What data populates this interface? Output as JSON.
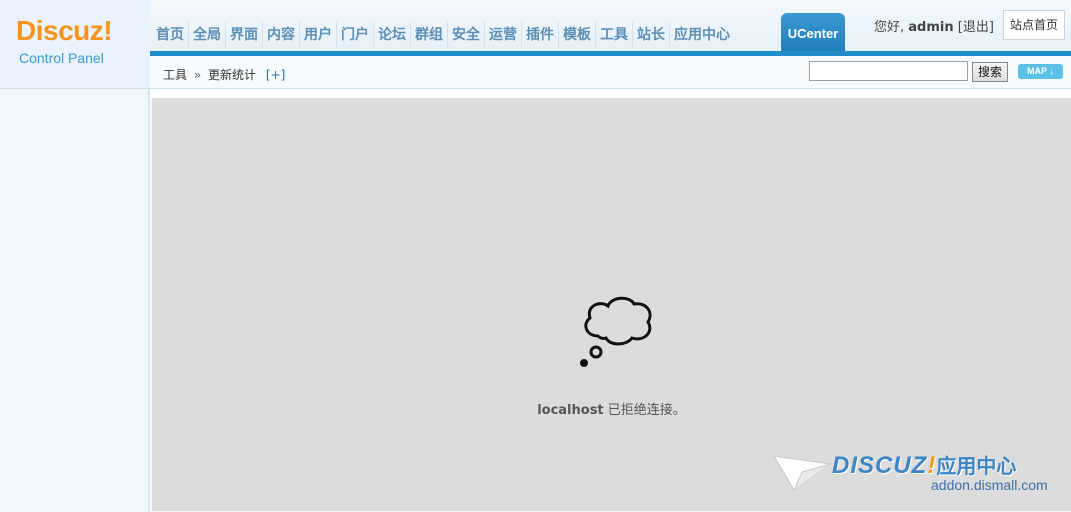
{
  "logo": {
    "word": "Discuz!",
    "sub": "Control Panel"
  },
  "nav": {
    "items": [
      "首页",
      "全局",
      "界面",
      "内容",
      "用户",
      "门户",
      "论坛",
      "群组",
      "安全",
      "运营",
      "插件",
      "模板",
      "工具",
      "站长",
      "应用中心"
    ],
    "active": "UCenter"
  },
  "user": {
    "greeting": "您好,",
    "name": "admin",
    "logout": "[退出]"
  },
  "home_button": "站点首页",
  "breadcrumb": {
    "section": "工具",
    "sep": "»",
    "page": "更新统计",
    "add": "[+]"
  },
  "search": {
    "value": "",
    "button": "搜索"
  },
  "map_button": "MAP",
  "error": {
    "host": "localhost",
    "message": "已拒绝连接。"
  },
  "watermark": {
    "logo_text": "DISCUZ",
    "bang": "!",
    "cn": "应用中心",
    "url": "addon.dismall.com"
  },
  "colors": {
    "accent": "#1f8ccb",
    "nav_text": "#5e8fb4",
    "logo_orange": "#f7941d"
  }
}
